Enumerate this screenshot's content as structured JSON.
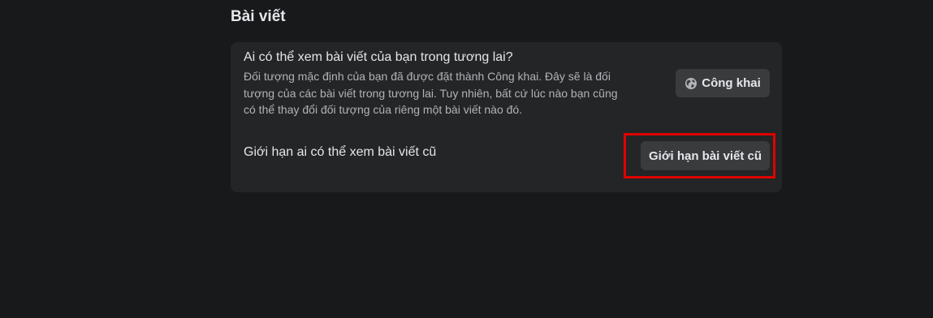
{
  "section": {
    "title": "Bài viết"
  },
  "future_posts": {
    "title": "Ai có thể xem bài viết của bạn trong tương lai?",
    "description_lines": [
      "Đối tượng mặc định của bạn đã được đặt thành Công khai. Đây sẽ là đối",
      "tượng của các bài viết trong tương lai. Tuy nhiên, bất cứ lúc nào bạn cũng",
      "có thể thay đổi đối tượng của riêng một bài viết nào đó."
    ],
    "button_label": "Công khai",
    "button_icon": "globe-icon"
  },
  "past_posts": {
    "title": "Giới hạn ai có thể xem bài viết cũ",
    "button_label": "Giới hạn bài viết cũ"
  },
  "colors": {
    "background": "#18191a",
    "card": "#242526",
    "button": "#3a3b3c",
    "highlight": "#e00000"
  }
}
